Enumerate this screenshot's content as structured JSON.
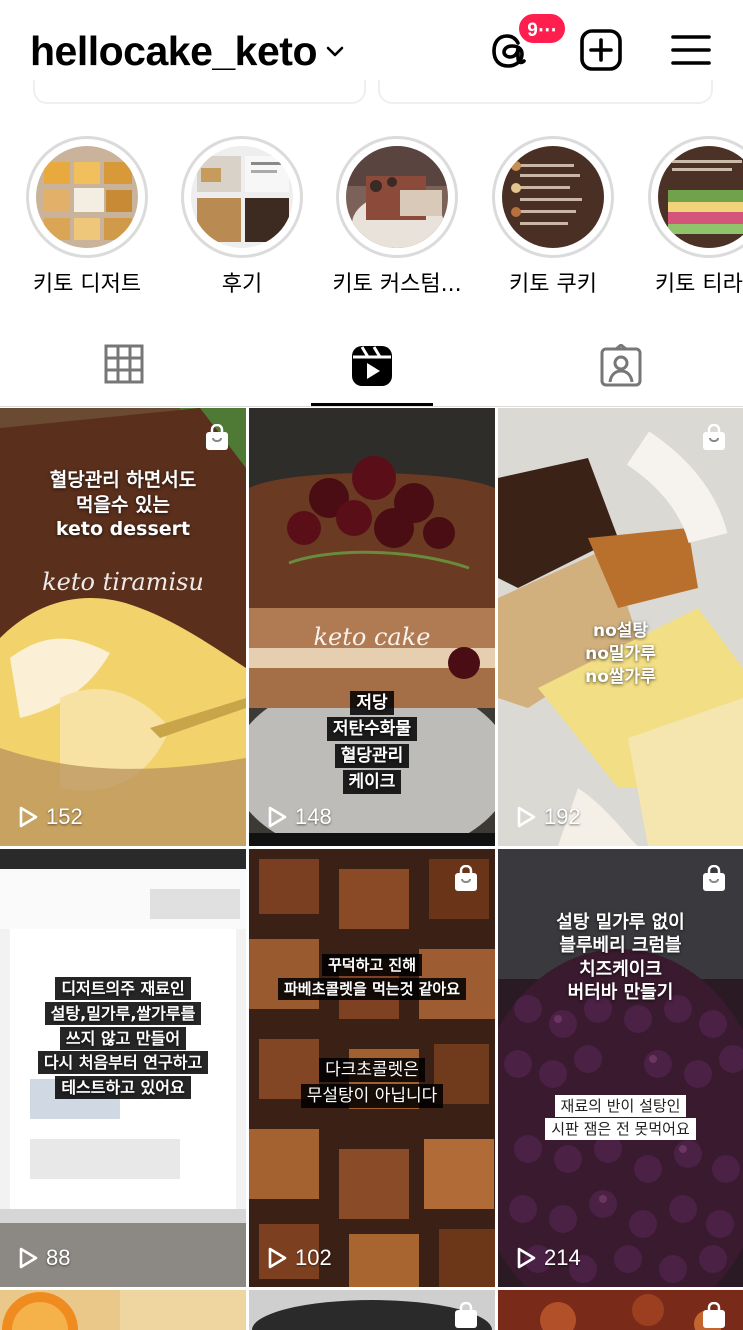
{
  "header": {
    "username": "hellocake_keto",
    "notification_badge": "9⋯",
    "icons": [
      "threads-icon",
      "create-post-icon",
      "menu-icon"
    ]
  },
  "highlights": [
    {
      "label": "키토 디저트"
    },
    {
      "label": "후기"
    },
    {
      "label": "키토 커스텀..."
    },
    {
      "label": "키토 쿠키"
    },
    {
      "label": "키토 티라미"
    }
  ],
  "tabs": [
    "grid-tab",
    "reels-tab",
    "tagged-tab"
  ],
  "reels": [
    {
      "views": "152",
      "caption": "혈당관리 하면서도\n먹을수 있는\nketo dessert",
      "overlay": "keto tiramisu"
    },
    {
      "views": "148",
      "caption": "저당\n저탄수화물\n혈당관리\n케이크",
      "overlay": "keto cake"
    },
    {
      "views": "192",
      "caption": "no설탕\nno밀가루\nno쌀가루"
    },
    {
      "views": "88",
      "caption": "디저트의주 재료인\n설탕,밀가루,쌀가루를\n쓰지 않고 만들어\n다시 처음부터 연구하고\n테스트하고 있어요"
    },
    {
      "views": "102",
      "caption": "꾸덕하고 진해\n파베초콜렛을 먹는것 같아요",
      "caption2": "다크초콜렛은\n무설탕이 아닙니다"
    },
    {
      "views": "214",
      "caption": "설탕 밀가루 없이\n블루베리 크럼블\n치즈케이크\n버터바 만들기",
      "caption2": "재료의 반이 설탕인\n시판 잼은 전 못먹어요"
    }
  ],
  "colors": {
    "accent_badge": "#ff1e4e",
    "divider": "#dbdbdb"
  }
}
